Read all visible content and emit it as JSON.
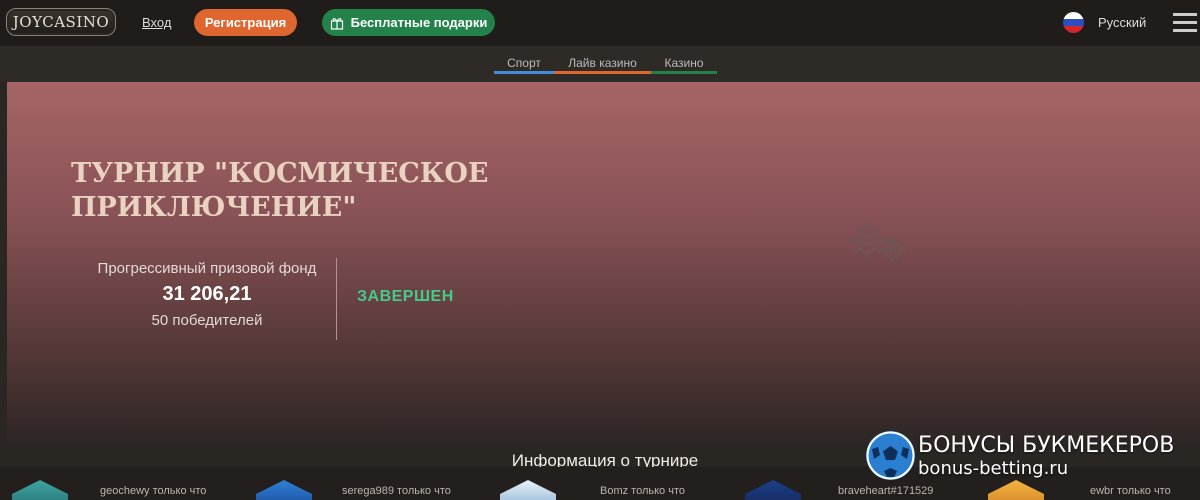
{
  "header": {
    "logo_text": "JOYCASINO",
    "login_label": "Вход",
    "register_label": "Регистрация",
    "gifts_label": "Бесплатные подарки",
    "language_label": "Русский"
  },
  "subnav": {
    "tabs": [
      {
        "label": "Спорт",
        "color": "#3e8ed8"
      },
      {
        "label": "Лайв казино",
        "color": "#e0662f"
      },
      {
        "label": "Казино",
        "color": "#23824a"
      }
    ]
  },
  "tournament": {
    "title": "ТУРНИР \"КОСМИЧЕСКОЕ ПРИКЛЮЧЕНИЕ\"",
    "fund_label": "Прогрессивный призовой фонд",
    "fund_value": "31 206,21",
    "winners_count": "50 победителей",
    "status": "ЗАВЕРШЕН",
    "status_color": "#46c98c"
  },
  "info_title": "Информация о турнире",
  "winners_feed": [
    {
      "text": "geochewy только что"
    },
    {
      "text": "serega989 только что"
    },
    {
      "text": "Bomz только что"
    },
    {
      "text": "braveheart#171529"
    },
    {
      "text": "ewbr только что"
    }
  ],
  "watermark": {
    "line1": "БОНУСЫ БУКМЕКЕРОВ",
    "line2": "bonus-betting.ru"
  },
  "colors": {
    "register_button": "#e0662f",
    "gifts_button": "#23824a",
    "banner_top": "#a56567",
    "background": "#2a2622"
  }
}
